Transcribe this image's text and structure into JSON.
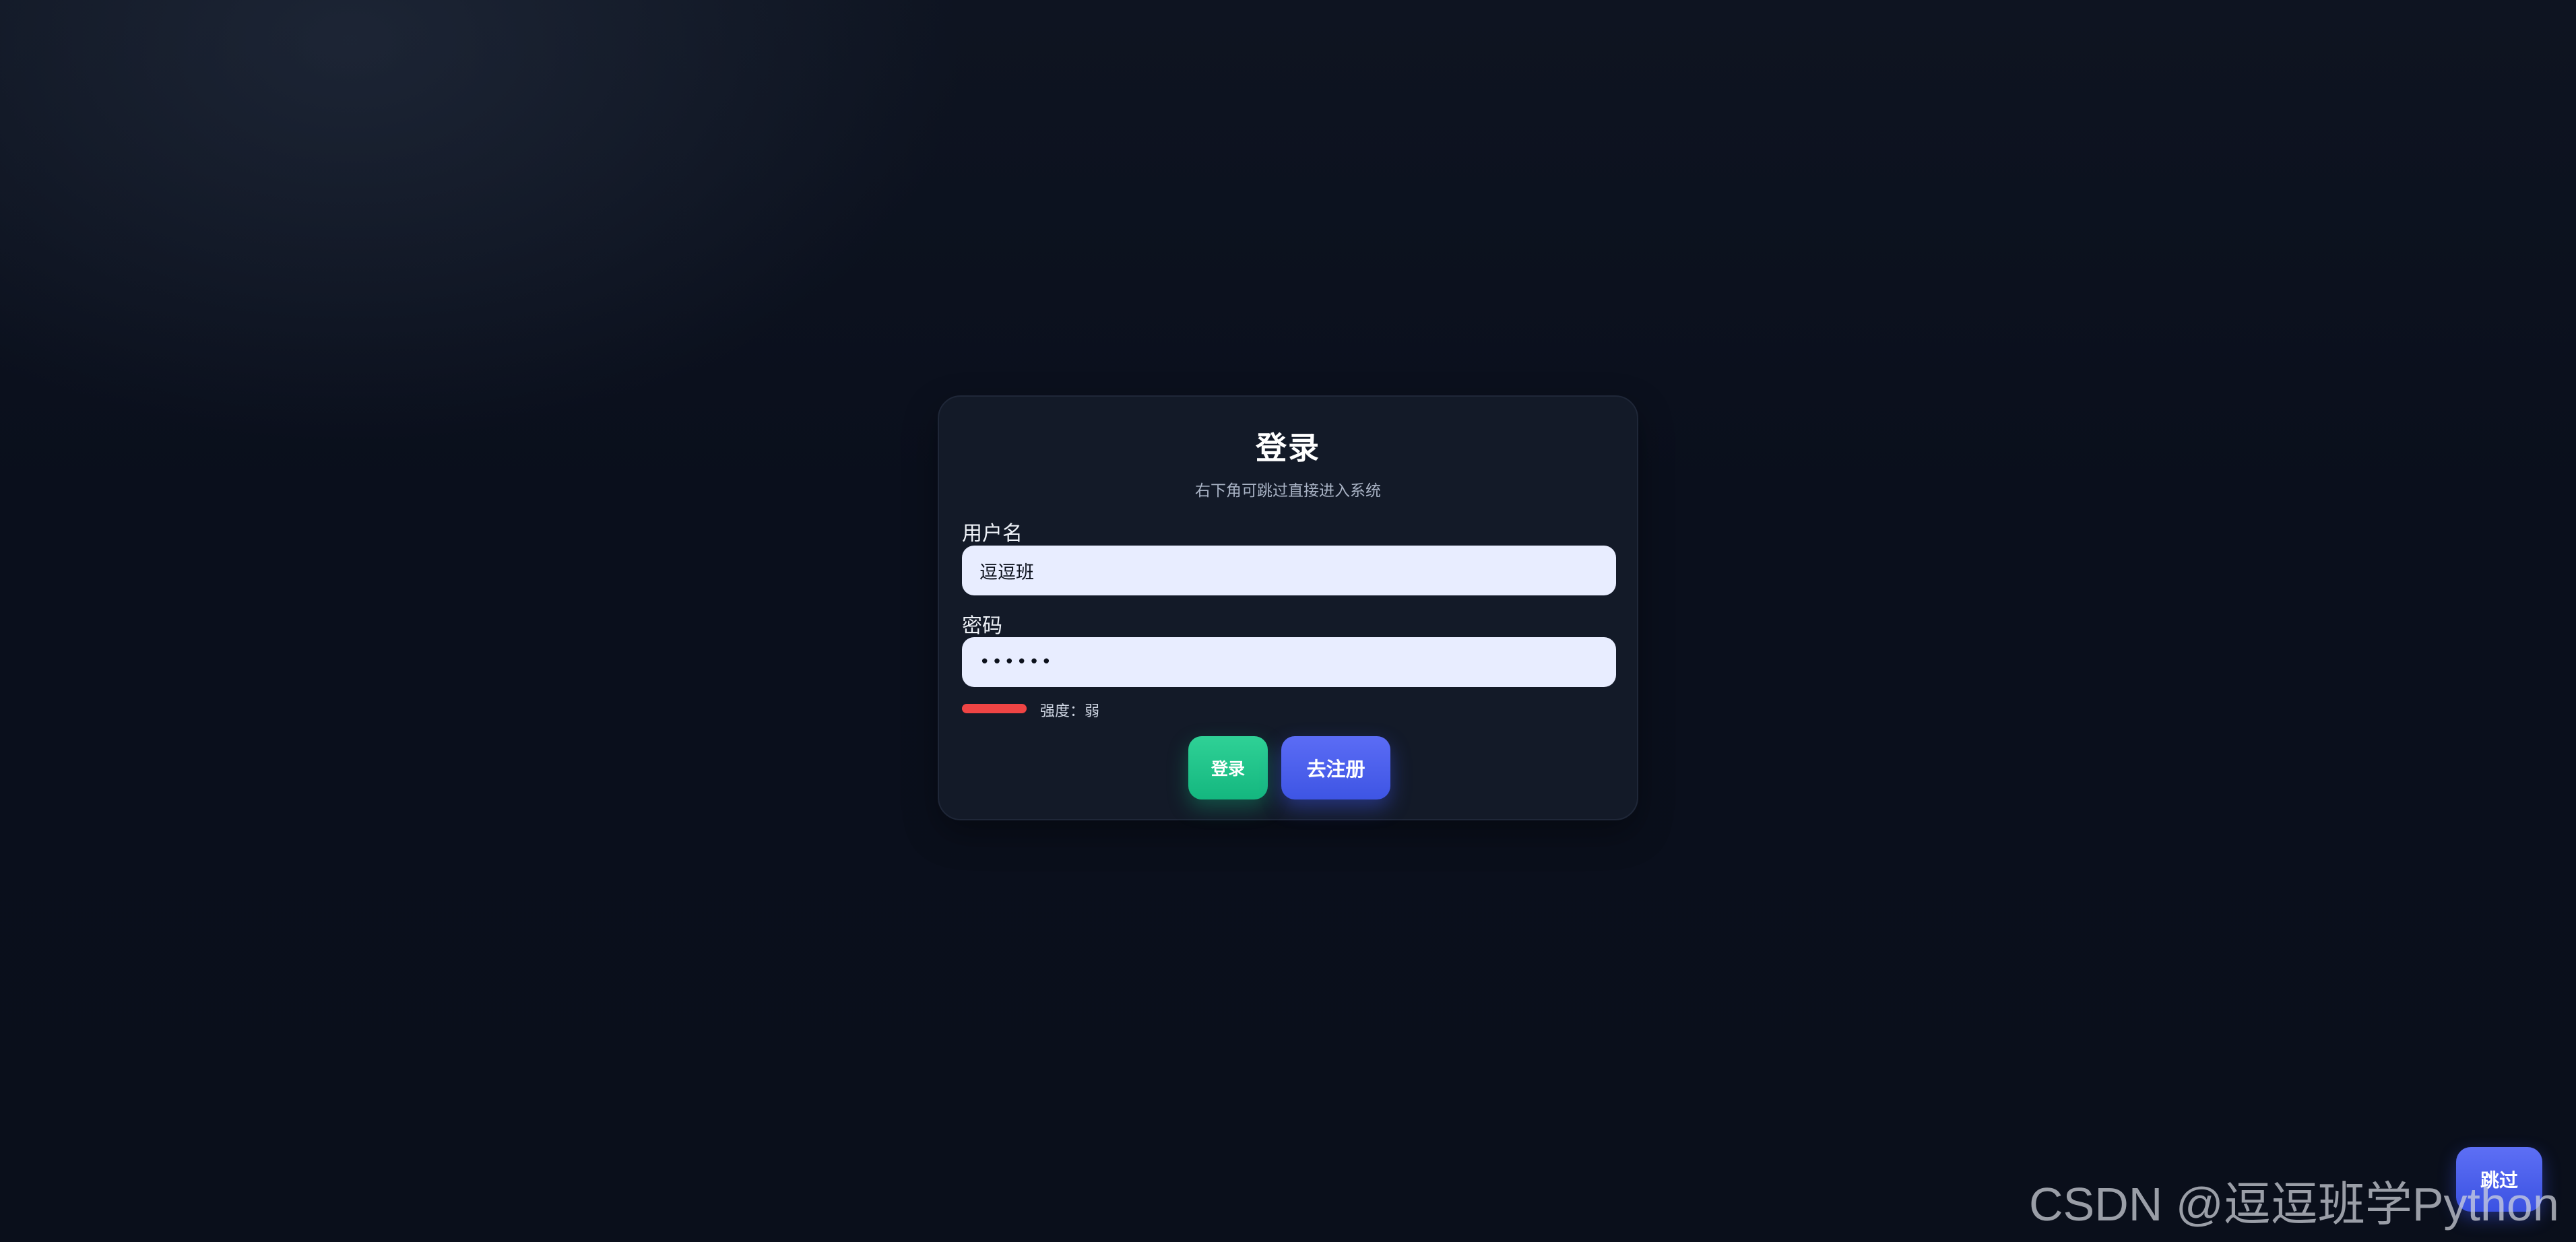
{
  "login_card": {
    "title": "登录",
    "subtitle": "右下角可跳过直接进入系统",
    "username": {
      "label": "用户名",
      "value": "逗逗班"
    },
    "password": {
      "label": "密码",
      "value": "••••••"
    },
    "strength": {
      "text": "强度：弱",
      "color": "#ef4444"
    },
    "buttons": {
      "login_label": "登录",
      "register_label": "去注册"
    }
  },
  "skip_button": {
    "label": "跳过"
  },
  "watermark": {
    "text": "CSDN @逗逗班学Python"
  },
  "colors": {
    "background": "#0a0f1c",
    "card": "#131a28",
    "input_bg": "#e8edff",
    "login_button": "#14b77f",
    "register_button": "#3e55e4",
    "skip_button": "#3b52e2"
  }
}
